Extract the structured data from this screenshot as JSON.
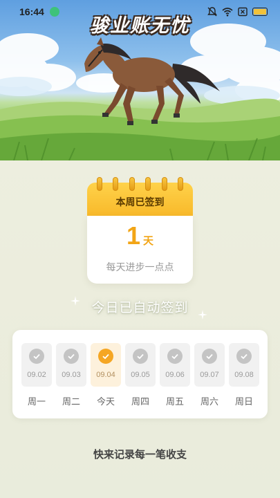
{
  "status_bar": {
    "time": "16:44",
    "icons": [
      "app-notification-icon",
      "bell-muted-icon",
      "wifi-icon",
      "sim-x-icon",
      "battery-icon"
    ],
    "battery_color": "#f2c23a"
  },
  "hero": {
    "title": "骏业账无忧"
  },
  "calendar": {
    "header": "本周已签到",
    "count": "1",
    "unit": "天",
    "subtitle": "每天进步一点点",
    "accent_color": "#f2a516"
  },
  "auto_sign": {
    "text": "今日已自动签到"
  },
  "week": {
    "days": [
      {
        "date": "09.02",
        "label": "周一",
        "checked": false,
        "today": false
      },
      {
        "date": "09.03",
        "label": "周二",
        "checked": false,
        "today": false
      },
      {
        "date": "09.04",
        "label": "今天",
        "checked": true,
        "today": true
      },
      {
        "date": "09.05",
        "label": "周四",
        "checked": false,
        "today": false
      },
      {
        "date": "09.06",
        "label": "周五",
        "checked": false,
        "today": false
      },
      {
        "date": "09.07",
        "label": "周六",
        "checked": false,
        "today": false
      },
      {
        "date": "09.08",
        "label": "周日",
        "checked": false,
        "today": false
      }
    ],
    "today_color": "#f5a623",
    "inactive_color": "#c4c4c4"
  },
  "footer": {
    "prompt": "快来记录每一笔收支"
  }
}
